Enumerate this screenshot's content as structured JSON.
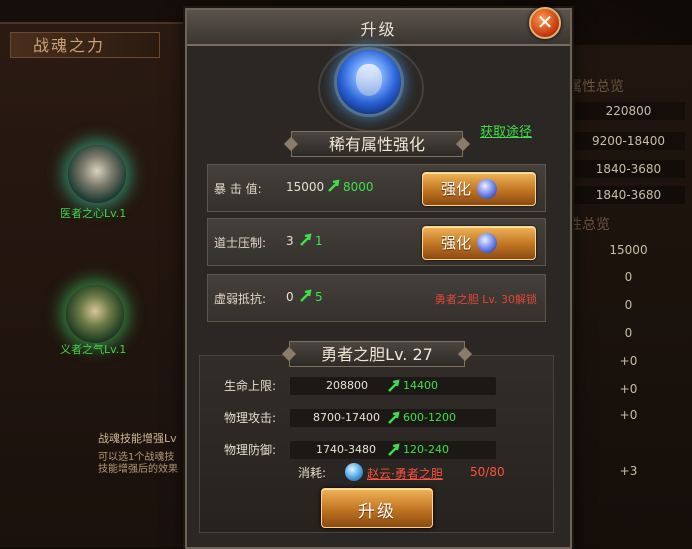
{
  "left": {
    "title": "战魂之力",
    "orb1_label": "医者之心Lv.1",
    "orb2_label": "义者之气Lv.1",
    "text1": "战魂技能增强Lv",
    "text2": "可以选1个战魂技",
    "text3": "技能增强后的效果"
  },
  "right": {
    "head1": "属性总览",
    "head2": "性总览",
    "values1": [
      "220800",
      "9200-18400",
      "1840-3680",
      "1840-3680"
    ],
    "values2": [
      "15000",
      "0",
      "0",
      "0",
      "+0",
      "+0",
      "+0",
      "+3"
    ]
  },
  "dialog": {
    "title": "升级",
    "close_label": "✕",
    "acquire_link": "获取途径",
    "section_title": "稀有属性强化",
    "attributes": [
      {
        "name": "暴 击 值:",
        "value": "15000",
        "add": "8000",
        "button": "强化"
      },
      {
        "name": "道士压制:",
        "value": "3",
        "add": "1",
        "button": "强化"
      },
      {
        "name": "虚弱抵抗:",
        "value": "0",
        "add": "5",
        "lock": "勇者之胆  Lv. 30解锁"
      }
    ],
    "level_title": "勇者之胆Lv. 27",
    "stats": [
      {
        "label": "生命上限:",
        "value": "208800",
        "add": "14400"
      },
      {
        "label": "物理攻击:",
        "value": "8700-17400",
        "add": "600-1200"
      },
      {
        "label": "物理防御:",
        "value": "1740-3480",
        "add": "120-240"
      }
    ],
    "cost_label": "消耗:",
    "cost_item": "赵云·勇者之胆",
    "cost_count": "50/80",
    "upgrade_button": "升级"
  },
  "colors": {
    "increase": "#3fe04a",
    "warning": "#ff5040",
    "button_gold": "#c07422"
  },
  "icons": {
    "close": "close-icon",
    "increase": "up-arrow-icon",
    "gem": "gem-icon",
    "emblem": "hero-emblem-icon"
  }
}
